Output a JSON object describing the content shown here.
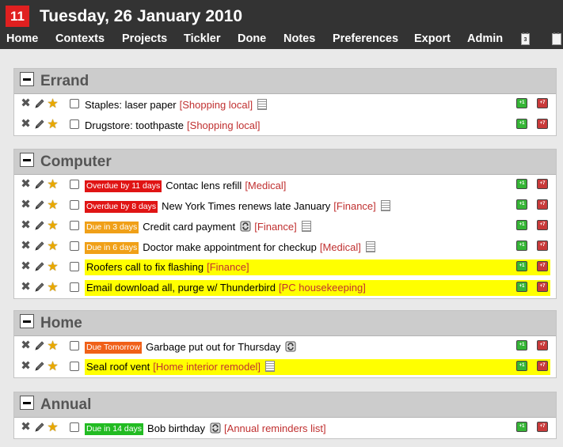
{
  "header": {
    "badge": "11",
    "date": "Tuesday, 26 January 2010"
  },
  "nav": {
    "items": [
      "Home",
      "Contexts",
      "Projects",
      "Tickler",
      "Done",
      "Notes",
      "Preferences",
      "Export",
      "Admin"
    ],
    "icons": [
      "calendar-icon",
      "print-icon"
    ]
  },
  "colors": {
    "overdue": "#e01414",
    "due_soon": "#f0a018",
    "due_tomorrow": "#f06018",
    "due_later": "#22bb22",
    "highlight": "#ffff00",
    "project_link": "#c03030"
  },
  "defer_labels": {
    "plus1": "+1",
    "plus7": "+7"
  },
  "contexts": [
    {
      "name": "Errand",
      "todos": [
        {
          "due": "",
          "desc": "Staples: laser paper",
          "project": "[Shopping local]",
          "note": true,
          "recurring": false,
          "highlight": false
        },
        {
          "due": "",
          "desc": "Drugstore: toothpaste",
          "project": "[Shopping local]",
          "note": false,
          "recurring": false,
          "highlight": false
        }
      ]
    },
    {
      "name": "Computer",
      "todos": [
        {
          "due": "Overdue by 11 days",
          "due_type": "overdue",
          "desc": "Contac lens refill",
          "project": "[Medical]",
          "note": false,
          "recurring": false,
          "highlight": false
        },
        {
          "due": "Overdue by 8 days",
          "due_type": "overdue",
          "desc": "New York Times renews late January",
          "project": "[Finance]",
          "note": true,
          "recurring": false,
          "highlight": false
        },
        {
          "due": "Due in 3 days",
          "due_type": "due_soon",
          "desc": "Credit card payment",
          "project": "[Finance]",
          "note": true,
          "recurring": true,
          "highlight": false
        },
        {
          "due": "Due in 6 days",
          "due_type": "due_soon",
          "desc": "Doctor make appointment for checkup",
          "project": "[Medical]",
          "note": true,
          "recurring": false,
          "highlight": false
        },
        {
          "due": "",
          "desc": "Roofers call to fix flashing",
          "project": "[Finance]",
          "note": false,
          "recurring": false,
          "highlight": true
        },
        {
          "due": "",
          "desc": "Email download all, purge w/ Thunderbird",
          "project": "[PC housekeeping]",
          "note": false,
          "recurring": false,
          "highlight": true
        }
      ]
    },
    {
      "name": "Home",
      "todos": [
        {
          "due": "Due Tomorrow",
          "due_type": "due_tomorrow",
          "desc": "Garbage put out for Thursday",
          "project": "",
          "note": false,
          "recurring": true,
          "highlight": false
        },
        {
          "due": "",
          "desc": "Seal roof vent",
          "project": "[Home interior remodel]",
          "note": true,
          "recurring": false,
          "highlight": true
        }
      ]
    },
    {
      "name": "Annual",
      "todos": [
        {
          "due": "Due in 14 days",
          "due_type": "due_later",
          "desc": "Bob birthday",
          "project": "[Annual reminders list]",
          "note": false,
          "recurring": true,
          "highlight": false
        }
      ]
    }
  ]
}
